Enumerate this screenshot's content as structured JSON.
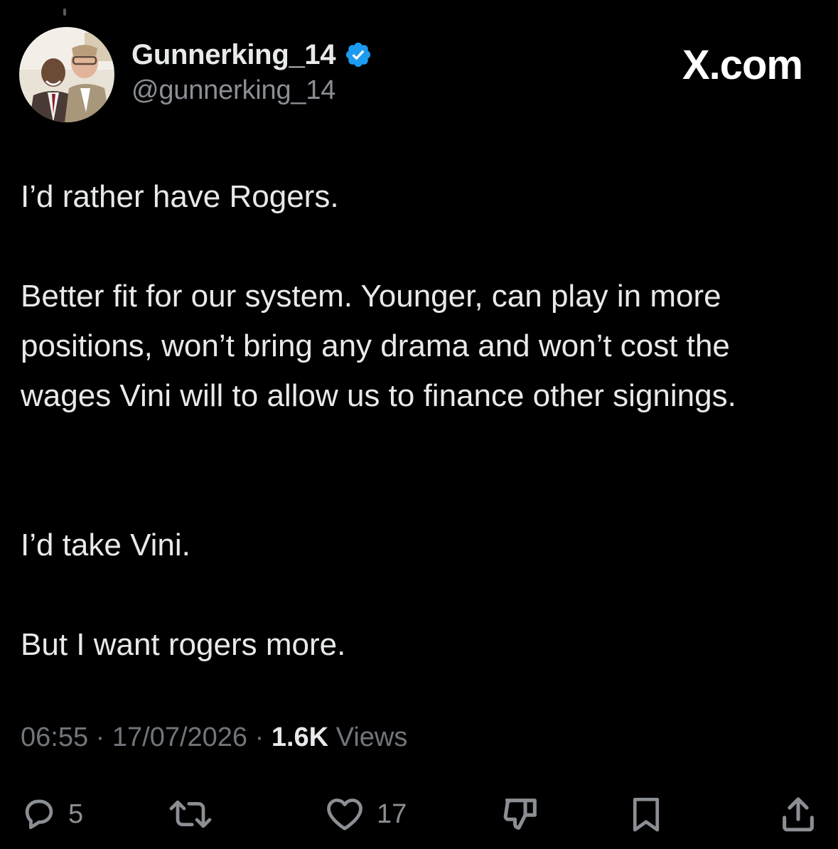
{
  "header": {
    "display_name": "Gunnerking_14",
    "handle": "@gunnerking_14",
    "brand": "X.com",
    "verified_color": "#1d9bf0"
  },
  "tweet": {
    "paragraphs": [
      "I’d rather have Rogers.",
      "Better fit for our system. Younger, can play in more positions, won’t bring any drama and won’t cost the wages Vini will to allow us to finance other signings.",
      "I’d take Vini.",
      "But I want rogers more."
    ]
  },
  "meta": {
    "time": "06:55",
    "separator": " · ",
    "date": "17/07/2026",
    "views_count": "1.6K",
    "views_label": " Views"
  },
  "actions": {
    "reply": {
      "icon": "reply-icon",
      "count": "5"
    },
    "retweet": {
      "icon": "retweet-icon",
      "count": ""
    },
    "like": {
      "icon": "heart-icon",
      "count": "17"
    },
    "downvote": {
      "icon": "downvote-icon",
      "count": ""
    },
    "bookmark": {
      "icon": "bookmark-icon",
      "count": ""
    },
    "share": {
      "icon": "share-icon",
      "count": ""
    }
  },
  "colors": {
    "background": "#000000",
    "text": "#e7e9ea",
    "secondary_text": "#71767b",
    "accent": "#1d9bf0"
  }
}
